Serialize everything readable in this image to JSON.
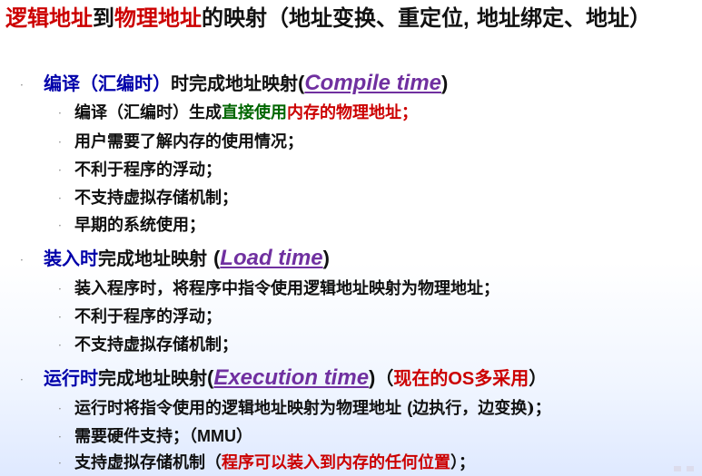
{
  "title": {
    "part1": "逻辑地址",
    "part2": "到",
    "part3": "物理地址",
    "part4": "的映射（地址变换、重定位",
    "part5": ",",
    "part6": " 地址绑定、地址）"
  },
  "bullets_glyph": "·",
  "compile": {
    "head_blue": "编译（汇编时）",
    "head_rest": "时完成地址映射",
    "paren_open": "(",
    "english": "Compile time",
    "paren_close": ")",
    "items": [
      {
        "a": "编译（汇编时）生成",
        "b": "直接使用",
        "c": "内存的物理地址；"
      },
      {
        "a": "用户需要了解内存的使用情况；"
      },
      {
        "a": "不利于程序的浮动；"
      },
      {
        "a": "不支持虚拟存储机制；"
      },
      {
        "a": "早期的系统使用；"
      }
    ]
  },
  "load": {
    "head_blue": "装入时",
    "head_rest": "完成地址映射 ",
    "paren_open": "(",
    "english": "Load time",
    "paren_close": ")",
    "items": [
      {
        "a": "装入程序时，将程序中指令使用逻辑地址映射为物理地址；"
      },
      {
        "a": "不利于程序的浮动；"
      },
      {
        "a": "不支持虚拟存储机制；"
      }
    ]
  },
  "exec": {
    "head_blue": "运行时",
    "head_rest": "完成地址映射",
    "paren_open": "(",
    "english": "Execution time",
    "paren_close": ")",
    "note_open": "（",
    "note_red1": "现在的",
    "note_os": "OS",
    "note_red2": "多采用",
    "note_close": "）",
    "items": [
      {
        "a": "运行时将指令使用的逻辑地址映射为物理地址 ",
        "b": "(",
        "c": "边执行，边变换",
        "d": ")；"
      },
      {
        "a": "需要硬件支持；（",
        "b": "MMU",
        "c": "）"
      },
      {
        "a": "支持虚拟存储机制（",
        "b": "程序可以装入到内存的任何位置",
        "c": "）；"
      }
    ]
  },
  "colors": {
    "red": "#cc0000",
    "blue": "#0000aa",
    "green": "#006600",
    "purple": "#7030a0"
  }
}
